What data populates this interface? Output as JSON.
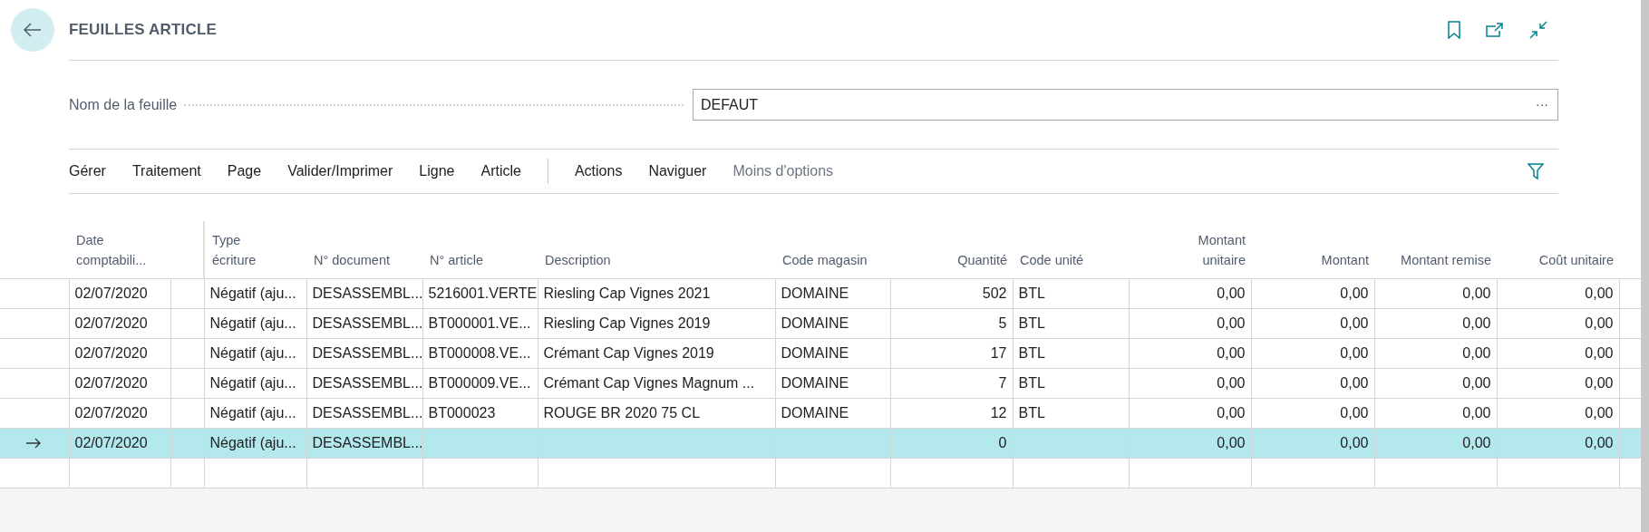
{
  "page": {
    "title": "FEUILLES ARTICLE"
  },
  "field": {
    "label": "Nom de la feuille",
    "value": "DEFAUT",
    "more": "···"
  },
  "action_groups": [
    {
      "items": [
        "Gérer",
        "Traitement",
        "Page",
        "Valider/Imprimer",
        "Ligne",
        "Article"
      ]
    },
    {
      "items": [
        "Actions",
        "Naviguer"
      ]
    }
  ],
  "options_toggle": "Moins d'options",
  "columns": [
    {
      "label": "Date comptabili...",
      "kind": "text"
    },
    {
      "label": "Type écriture",
      "kind": "text"
    },
    {
      "label": "N° document",
      "kind": "text"
    },
    {
      "label": "N° article",
      "kind": "text"
    },
    {
      "label": "Description",
      "kind": "text"
    },
    {
      "label": "Code magasin",
      "kind": "text"
    },
    {
      "label": "Quantité",
      "kind": "number"
    },
    {
      "label": "Code unité",
      "kind": "text"
    },
    {
      "label": "Montant unitaire",
      "kind": "number"
    },
    {
      "label": "Montant",
      "kind": "number"
    },
    {
      "label": "Montant remise",
      "kind": "number"
    },
    {
      "label": "Coût unitaire",
      "kind": "number"
    }
  ],
  "rows": [
    {
      "selected": false,
      "cells": [
        "02/07/2020",
        "Négatif (aju...",
        "DESASSEMBL...",
        "5216001.VERTE",
        "Riesling Cap Vignes 2021",
        "DOMAINE",
        "502",
        "BTL",
        "0,00",
        "0,00",
        "0,00",
        "0,00"
      ]
    },
    {
      "selected": false,
      "cells": [
        "02/07/2020",
        "Négatif (aju...",
        "DESASSEMBL...",
        "BT000001.VE...",
        "Riesling Cap Vignes 2019",
        "DOMAINE",
        "5",
        "BTL",
        "0,00",
        "0,00",
        "0,00",
        "0,00"
      ]
    },
    {
      "selected": false,
      "cells": [
        "02/07/2020",
        "Négatif (aju...",
        "DESASSEMBL...",
        "BT000008.VE...",
        "Crémant Cap Vignes 2019",
        "DOMAINE",
        "17",
        "BTL",
        "0,00",
        "0,00",
        "0,00",
        "0,00"
      ]
    },
    {
      "selected": false,
      "cells": [
        "02/07/2020",
        "Négatif (aju...",
        "DESASSEMBL...",
        "BT000009.VE...",
        "Crémant Cap Vignes Magnum ...",
        "DOMAINE",
        "7",
        "BTL",
        "0,00",
        "0,00",
        "0,00",
        "0,00"
      ]
    },
    {
      "selected": false,
      "cells": [
        "02/07/2020",
        "Négatif (aju...",
        "DESASSEMBL...",
        "BT000023",
        "ROUGE BR 2020 75 CL",
        "DOMAINE",
        "12",
        "BTL",
        "0,00",
        "0,00",
        "0,00",
        "0,00"
      ]
    },
    {
      "selected": true,
      "cells": [
        "02/07/2020",
        "Négatif (aju...",
        "DESASSEMBL...",
        null,
        null,
        null,
        "0",
        null,
        "0,00",
        "0,00",
        "0,00",
        "0,00"
      ]
    }
  ]
}
